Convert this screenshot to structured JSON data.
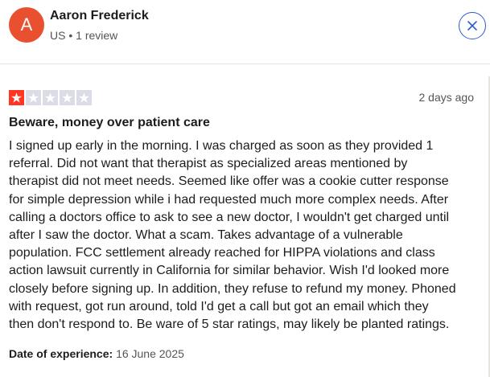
{
  "reviewer": {
    "initial": "A",
    "name": "Aaron Frederick",
    "country": "US",
    "separator": "•",
    "review_count": "1 review",
    "avatar_color": "#e8502f"
  },
  "review": {
    "rating": 1,
    "max_rating": 5,
    "rating_color": "#ff3722",
    "empty_star_color": "#dcdce6",
    "date": "2 days ago",
    "title": "Beware, money over patient care",
    "body_lines": [
      "I signed up early in the morning. I was charged as soon as they provided 1",
      "referral. Did not want that therapist as specialized areas mentioned by",
      "therapist did not meet needs. Seemed like offer was a cookie cutter response",
      "for simple depression while i had requested much more complex needs. After",
      "calling a doctors office to ask to see a new doctor, I wouldn't get charged until",
      "after I saw the doctor. What a scam. Takes advantage of a vulnerable",
      "population. FCC settlement already reached for HIPPA violations and class",
      "action lawsuit currently in California for similar behavior. Wish I'd looked more",
      "closely before signing up. In addition, they refuse to refund my money. Phoned",
      "with request, got run around, told I'd get a call but got an email which they",
      "then don't respond to. Be ware of 5 star ratings, may likely be planted ratings."
    ],
    "experience_label": "Date of experience:",
    "experience_date": "16 June 2025"
  },
  "controls": {
    "close_icon": "close-icon",
    "accent_color": "#2d5bd1"
  }
}
